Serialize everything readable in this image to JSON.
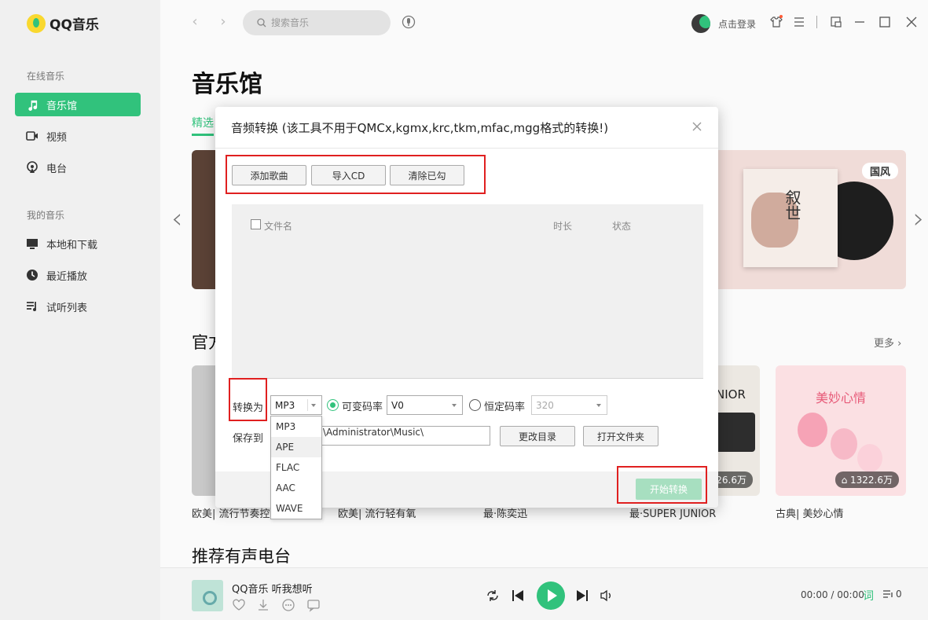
{
  "app": {
    "name": "QQ音乐"
  },
  "sidebar": {
    "section_online": "在线音乐",
    "section_mine": "我的音乐",
    "online_items": [
      {
        "label": "音乐馆",
        "icon": "music-note-icon",
        "active": true
      },
      {
        "label": "视频",
        "icon": "video-icon",
        "active": false
      },
      {
        "label": "电台",
        "icon": "radio-icon",
        "active": false
      }
    ],
    "mine_items": [
      {
        "label": "本地和下载",
        "icon": "computer-icon"
      },
      {
        "label": "最近播放",
        "icon": "clock-icon"
      },
      {
        "label": "试听列表",
        "icon": "playlist-icon"
      }
    ]
  },
  "topbar": {
    "search_placeholder": "搜索音乐",
    "login_label": "点击登录"
  },
  "main": {
    "page_title": "音乐馆",
    "active_tab": "精选",
    "banner_badge": "国风",
    "banner_album_text": "叙世",
    "section_title": "官方",
    "more_label": "更多",
    "cards": [
      {
        "caption": "欧美| 流行节奏控",
        "color": "#c9c9c9"
      },
      {
        "caption": "欧美| 流行轻有氧",
        "color": "#d8d0c4"
      },
      {
        "caption": "最·陈奕迅",
        "color": "#bfb6aa"
      },
      {
        "caption": "最·SUPER JUNIOR",
        "count": "26.6万",
        "art_text": "NIOR",
        "color": "#ece8e2"
      },
      {
        "caption": "古典| 美妙心情",
        "count": "1322.6万",
        "art_text": "美妙心情",
        "color": "#fbe0e3"
      }
    ],
    "rec_title": "推荐有声电台"
  },
  "player": {
    "song": "QQ音乐 听我想听",
    "time": "00:00 / 00:00",
    "lyric_label": "词",
    "queue_count": "0"
  },
  "dialog": {
    "title": "音频转换 (该工具不用于QMCx,kgmx,krc,tkm,mfac,mgg格式的转换!)",
    "buttons": {
      "add": "添加歌曲",
      "import_cd": "导入CD",
      "clear": "清除已勾"
    },
    "columns": {
      "filename": "文件名",
      "duration": "时长",
      "status": "状态"
    },
    "convert_to_label": "转换为",
    "format_value": "MP3",
    "vbr_label": "可变码率",
    "vbr_value": "V0",
    "cbr_label": "恒定码率",
    "cbr_value": "320",
    "save_to_label": "保存到",
    "save_path": "\\Administrator\\Music\\",
    "change_dir": "更改目录",
    "open_folder": "打开文件夹",
    "start_label": "开始转换",
    "format_options": [
      "MP3",
      "APE",
      "FLAC",
      "AAC",
      "WAVE"
    ]
  },
  "colors": {
    "accent": "#31c27c",
    "highlight": "#e02020"
  }
}
